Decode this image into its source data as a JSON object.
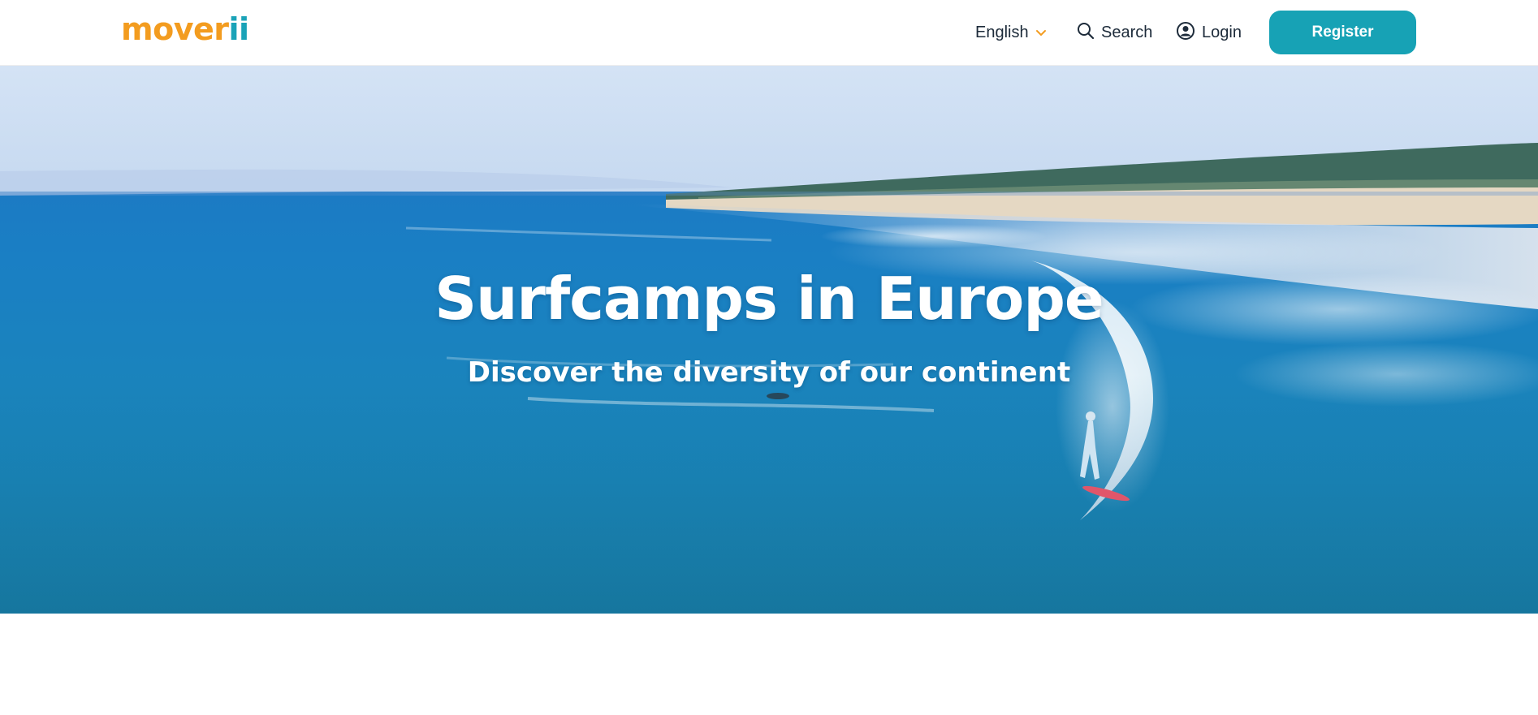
{
  "header": {
    "logo_main": "mover",
    "logo_accent": "ii",
    "language_label": "English",
    "search_label": "Search",
    "login_label": "Login",
    "register_label": "Register"
  },
  "hero": {
    "title": "Surfcamps in Europe",
    "subtitle": "Discover the diversity of our continent"
  },
  "colors": {
    "brand_orange": "#f39c1f",
    "brand_teal": "#17a2b5",
    "nav_text": "#1d2b3a"
  },
  "icons": {
    "language_chevron": "chevron-down-icon",
    "search": "search-icon",
    "login": "user-circle-icon",
    "hero_image": "surfer-ocean-beach-photo"
  }
}
